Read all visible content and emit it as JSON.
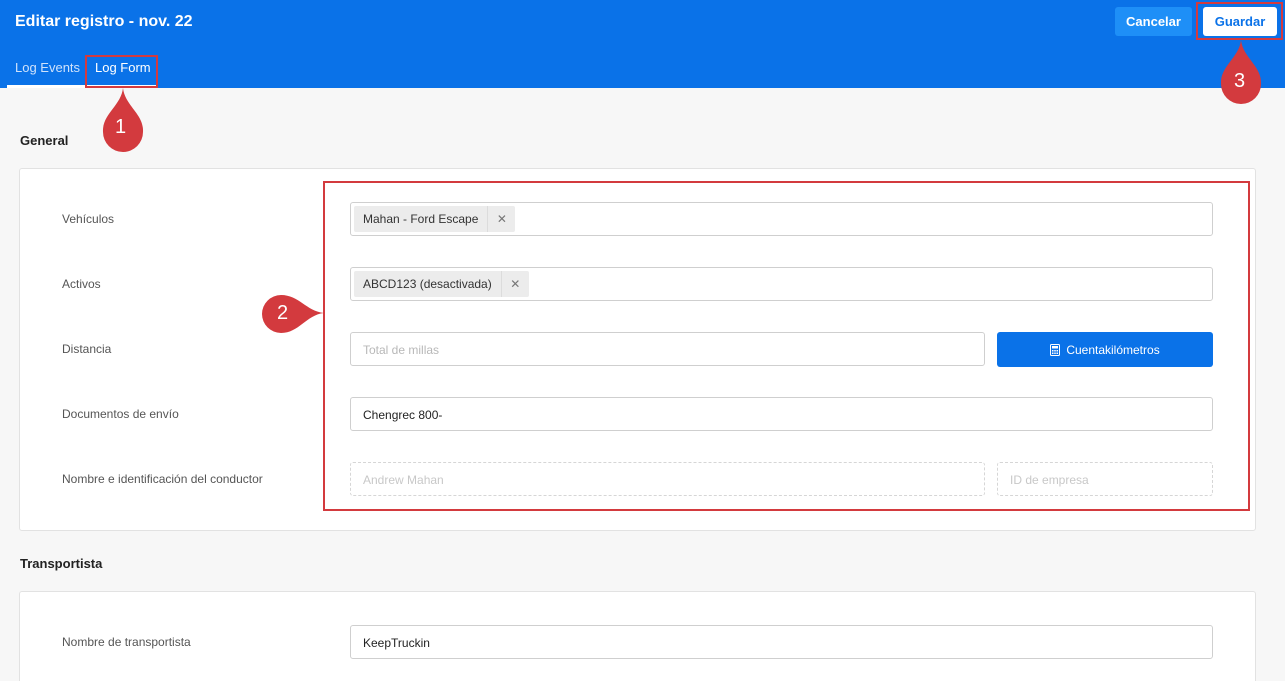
{
  "header": {
    "title": "Editar registro - nov. 22",
    "cancel_label": "Cancelar",
    "save_label": "Guardar",
    "tabs": [
      {
        "label": "Log Events"
      },
      {
        "label": "Log Form"
      }
    ]
  },
  "general": {
    "section_title": "General",
    "vehicles": {
      "label": "Vehículos",
      "chip": "Mahan - Ford Escape"
    },
    "assets": {
      "label": "Activos",
      "chip": "ABCD123 (desactivada)"
    },
    "distance": {
      "label": "Distancia",
      "placeholder": "Total de millas",
      "button_label": "Cuentakilómetros"
    },
    "shipping": {
      "label": "Documentos de envío",
      "value": "Chengrec 800-"
    },
    "driver": {
      "label": "Nombre e identificación del conductor",
      "name_placeholder": "Andrew Mahan",
      "id_placeholder": "ID de empresa"
    }
  },
  "carrier": {
    "section_title": "Transportista",
    "name": {
      "label": "Nombre de transportista",
      "value": "KeepTruckin"
    }
  },
  "annotations": [
    {
      "number": "1"
    },
    {
      "number": "2"
    },
    {
      "number": "3"
    }
  ],
  "colors": {
    "header_blue": "#0a72e8",
    "annotation_red": "#d33a3e"
  },
  "icons": {
    "chip_close": "close-icon",
    "odometer_button": "calculator-icon"
  }
}
